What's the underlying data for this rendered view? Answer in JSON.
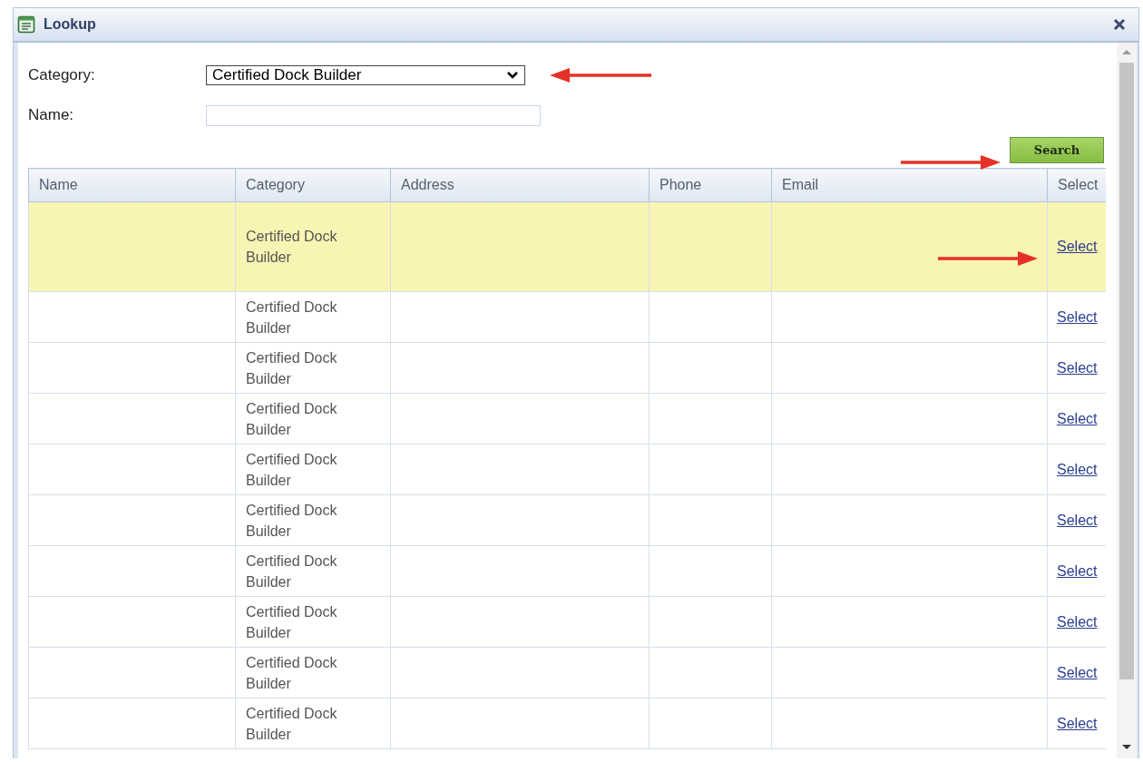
{
  "window": {
    "title": "Lookup"
  },
  "form": {
    "category_label": "Category:",
    "category_value": "Certified Dock Builder",
    "name_label": "Name:",
    "search_button": "Search"
  },
  "table": {
    "columns": [
      "Name",
      "Category",
      "Address",
      "Phone",
      "Email",
      "Select"
    ],
    "rows": [
      {
        "category": "Certified Dock Builder",
        "link": "Select",
        "selected": true
      },
      {
        "category": "Certified Dock Builder",
        "link": "Select",
        "selected": false
      },
      {
        "category": "Certified Dock Builder",
        "link": "Select",
        "selected": false
      },
      {
        "category": "Certified Dock Builder",
        "link": "Select",
        "selected": false
      },
      {
        "category": "Certified Dock Builder",
        "link": "Select",
        "selected": false
      },
      {
        "category": "Certified Dock Builder",
        "link": "Select",
        "selected": false
      },
      {
        "category": "Certified Dock Builder",
        "link": "Select",
        "selected": false
      },
      {
        "category": "Certified Dock Builder",
        "link": "Select",
        "selected": false
      },
      {
        "category": "Certified Dock Builder",
        "link": "Select",
        "selected": false
      },
      {
        "category": "Certified Dock Builder",
        "link": "Select",
        "selected": false
      }
    ]
  }
}
